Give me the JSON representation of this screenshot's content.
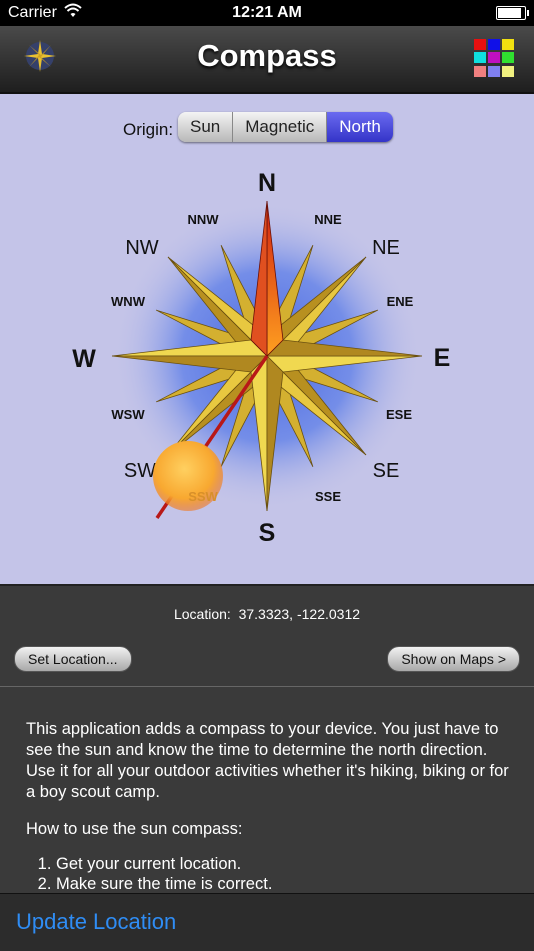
{
  "status_bar": {
    "carrier": "Carrier",
    "time": "12:21 AM",
    "battery_level": 0.9
  },
  "nav": {
    "title": "Compass",
    "left_icon": "compass-rose-icon",
    "right_icon": "color-grid-icon",
    "grid_colors": [
      "#e81010",
      "#1010e8",
      "#f0e010",
      "#10e0e0",
      "#c010c0",
      "#30e030",
      "#f08080",
      "#8080f0",
      "#f0f080"
    ]
  },
  "origin": {
    "label": "Origin:",
    "options": [
      "Sun",
      "Magnetic",
      "North"
    ],
    "selected": "North"
  },
  "compass": {
    "cardinals": {
      "N": "N",
      "S": "S",
      "E": "E",
      "W": "W"
    },
    "intercardinals": {
      "NE": "NE",
      "NW": "NW",
      "SE": "SE",
      "SW": "SW"
    },
    "secondary": {
      "NNE": "NNE",
      "NNW": "NNW",
      "ENE": "ENE",
      "WNW": "WNW",
      "ESE": "ESE",
      "WSW": "WSW",
      "SSE": "SSE",
      "SSW": "SSW"
    },
    "sun_direction": "SSW"
  },
  "location": {
    "label": "Location:",
    "value": "37.3323,  -122.0312"
  },
  "buttons": {
    "set_location": "Set Location...",
    "show_on_maps": "Show on Maps >"
  },
  "description": {
    "para1": "This application adds a compass to your device. You just have to see the sun and know the time to determine the north direction. Use it for all your outdoor activities whether it's hiking, biking or for a boy scout camp.",
    "para2": "How to use the sun compass:",
    "steps": [
      "Get your current location.",
      "Make sure the time is correct."
    ]
  },
  "bottom": {
    "update_location": "Update Location"
  }
}
